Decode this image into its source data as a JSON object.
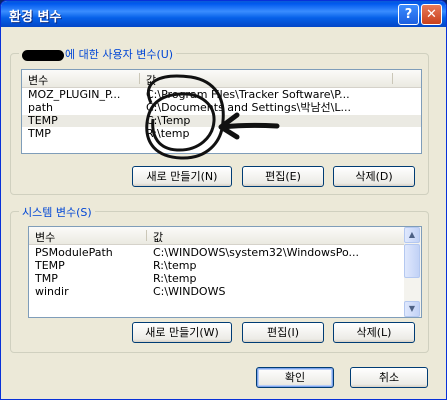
{
  "window": {
    "title": "환경 변수",
    "help_glyph": "?",
    "close_glyph": "✕"
  },
  "user_vars": {
    "label_suffix": "에 대한 사용자 변수(U)",
    "columns": [
      "변수",
      "값"
    ],
    "rows": [
      {
        "name": "MOZ_PLUGIN_P...",
        "value": "C:\\Program Files\\Tracker Software\\P..."
      },
      {
        "name": "path",
        "value": "C:\\Documents and Settings\\박남선\\L..."
      },
      {
        "name": "TEMP",
        "value": "C:\\Temp"
      },
      {
        "name": "TMP",
        "value": "R:\\temp"
      }
    ],
    "buttons": {
      "new": "새로 만들기(N)",
      "edit": "편집(E)",
      "delete": "삭제(D)"
    }
  },
  "system_vars": {
    "label": "시스템 변수(S)",
    "columns": [
      "변수",
      "값"
    ],
    "rows": [
      {
        "name": "PSModulePath",
        "value": "C:\\WINDOWS\\system32\\WindowsPo..."
      },
      {
        "name": "TEMP",
        "value": "R:\\temp"
      },
      {
        "name": "TMP",
        "value": "R:\\temp"
      },
      {
        "name": "windir",
        "value": "C:\\WINDOWS"
      }
    ],
    "buttons": {
      "new": "새로 만들기(W)",
      "edit": "편집(I)",
      "delete": "삭제(L)"
    }
  },
  "footer": {
    "ok": "확인",
    "cancel": "취소"
  },
  "scroll_glyphs": {
    "up": "▲",
    "down": "▼"
  }
}
